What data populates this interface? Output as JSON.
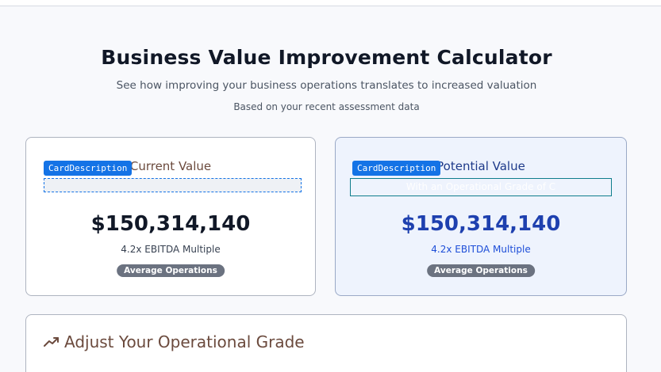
{
  "header": {
    "title": "Business Value Improvement Calculator",
    "subtitle": "See how improving your business operations translates to increased valuation",
    "note": "Based on your recent assessment data"
  },
  "cards": {
    "current": {
      "title": "Current Value",
      "tag": "CardDescription",
      "description": "",
      "amount": "$150,314,140",
      "multiple": "4.2x EBITDA Multiple",
      "badge": "Average Operations"
    },
    "potential": {
      "title": "Potential Value",
      "tag": "CardDescription",
      "description": "With an Operational Grade of C",
      "amount": "$150,314,140",
      "multiple": "4.2x EBITDA Multiple",
      "badge": "Average Operations"
    }
  },
  "adjust": {
    "icon": "trending-up-icon",
    "title": "Adjust Your Operational Grade"
  },
  "colors": {
    "accent_blue": "#1e40af",
    "tag_blue": "#1473e6",
    "brown_title": "#6b4a3d",
    "badge_gray": "#6b7280"
  }
}
